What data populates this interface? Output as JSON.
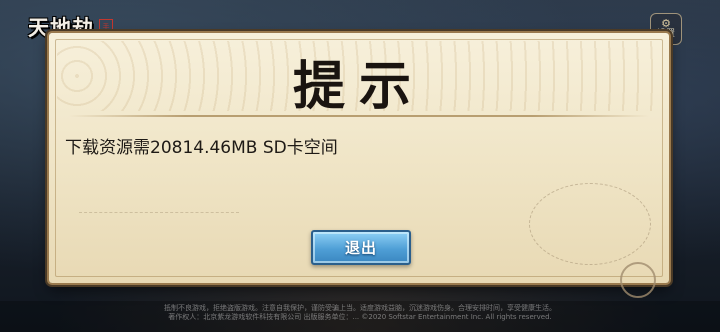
{
  "app": {
    "logo_text": "天地劫",
    "logo_seal": "手游",
    "settings_label": "设置",
    "settings_glyph": "⚙"
  },
  "dialog": {
    "title": "提示",
    "message": "下载资源需20814.46MB SD卡空间",
    "exit_label": "退出"
  },
  "footer": {
    "line1": "抵制不良游戏，拒绝盗版游戏。注意自我保护，谨防受骗上当。适度游戏益脑，沉迷游戏伤身。合理安排时间，享受健康生活。",
    "line2": "著作权人：北京紫龙游戏软件科技有限公司 出版服务单位：... ©2020 Softstar Entertainment Inc. All rights reserved."
  }
}
